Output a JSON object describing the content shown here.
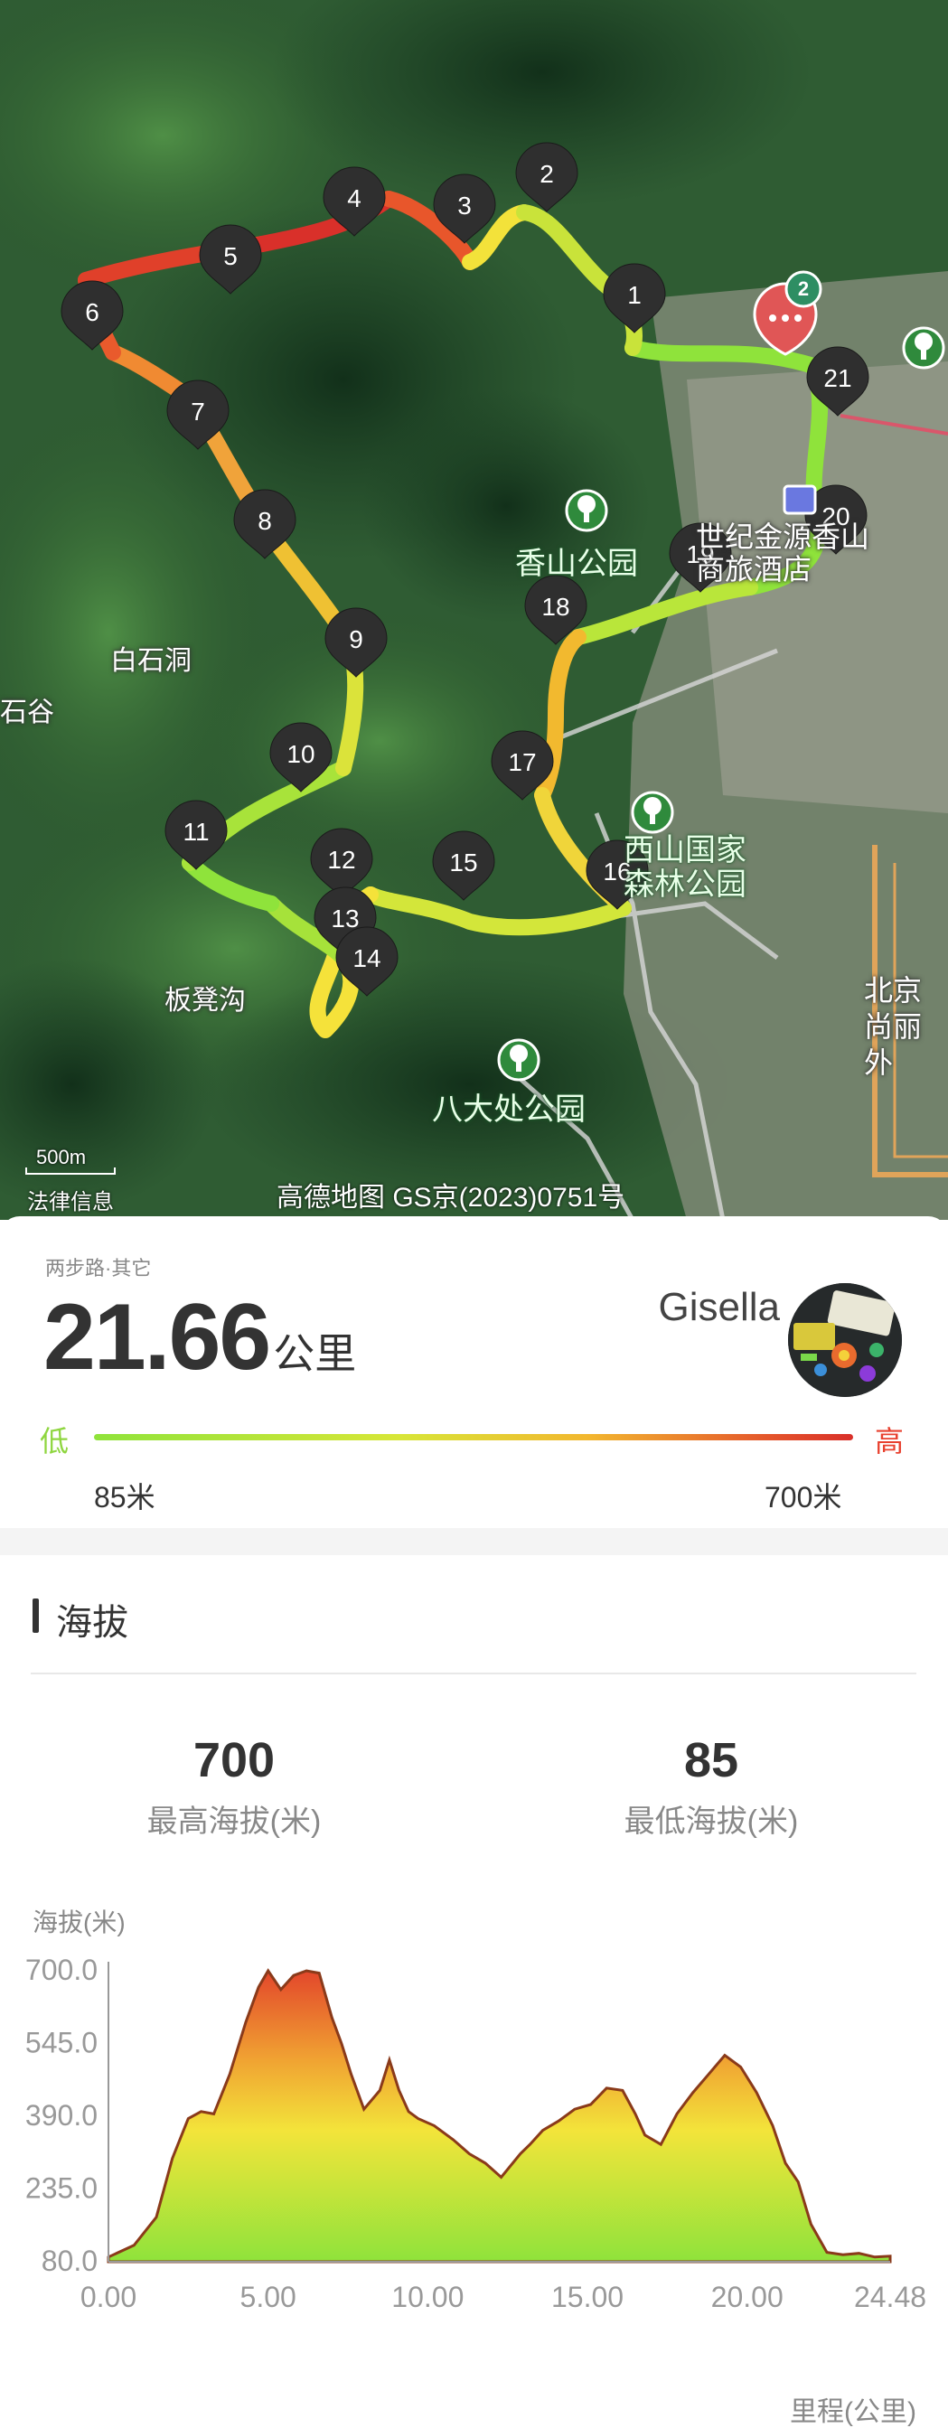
{
  "map": {
    "places": [
      "香山公园",
      "白石洞",
      "石谷",
      "板凳沟",
      "八大处公园",
      "西山国家森林公园",
      "世纪金源香山商旅酒店",
      "北京尚丽外"
    ],
    "notification_count": "2",
    "markers": [
      "1",
      "2",
      "3",
      "4",
      "5",
      "6",
      "7",
      "8",
      "9",
      "10",
      "11",
      "12",
      "13",
      "14",
      "15",
      "16",
      "17",
      "18",
      "19",
      "20",
      "21"
    ],
    "scale": "500m",
    "legal_link": "法律信息",
    "credit": "高德地图 GS京(2023)0751号",
    "colors": {
      "low": "#8fe33b",
      "mid": "#e9e13a",
      "high": "#d9302a"
    }
  },
  "stats": {
    "sport_type": "两步路·其它",
    "distance": "21.66",
    "distance_unit": "公里",
    "user_name": "Gisella",
    "legend_low": "低",
    "legend_high": "高",
    "legend_min": "85米",
    "legend_max": "700米"
  },
  "elevation": {
    "section_title": "海拔",
    "max_value": "700",
    "max_label": "最高海拔(米)",
    "min_value": "85",
    "min_label": "最低海拔(米)",
    "y_title": "海拔(米)",
    "x_title": "里程(公里)"
  },
  "chart_data": {
    "type": "area",
    "title": "",
    "ylabel": "海拔(米)",
    "xlabel": "里程(公里)",
    "ylim": [
      80,
      700
    ],
    "xlim": [
      0,
      24.48
    ],
    "yticks": [
      "700.0",
      "545.0",
      "390.0",
      "235.0",
      "80.0"
    ],
    "xticks": [
      "0.00",
      "5.00",
      "10.00",
      "15.00",
      "20.00",
      "24.48"
    ],
    "x": [
      0,
      0.8,
      1.5,
      2.0,
      2.5,
      2.9,
      3.3,
      3.8,
      4.3,
      4.7,
      5.0,
      5.4,
      5.8,
      6.2,
      6.6,
      7.0,
      7.3,
      7.6,
      8.0,
      8.5,
      8.8,
      9.1,
      9.4,
      9.7,
      10.2,
      10.8,
      11.3,
      11.8,
      12.3,
      12.9,
      13.2,
      13.6,
      14.1,
      14.6,
      15.1,
      15.6,
      16.1,
      16.5,
      16.8,
      17.3,
      17.8,
      18.3,
      18.8,
      19.3,
      19.8,
      20.3,
      20.8,
      21.2,
      21.6,
      22.0,
      22.5,
      23.0,
      23.5,
      24.0,
      24.48
    ],
    "values": [
      90,
      115,
      175,
      300,
      385,
      400,
      395,
      480,
      590,
      665,
      700,
      660,
      690,
      705,
      695,
      600,
      545,
      480,
      405,
      445,
      510,
      445,
      400,
      385,
      370,
      340,
      310,
      290,
      260,
      310,
      330,
      360,
      380,
      405,
      415,
      450,
      445,
      395,
      350,
      330,
      395,
      440,
      480,
      520,
      495,
      440,
      370,
      290,
      250,
      160,
      100,
      95,
      98,
      90,
      92
    ]
  }
}
